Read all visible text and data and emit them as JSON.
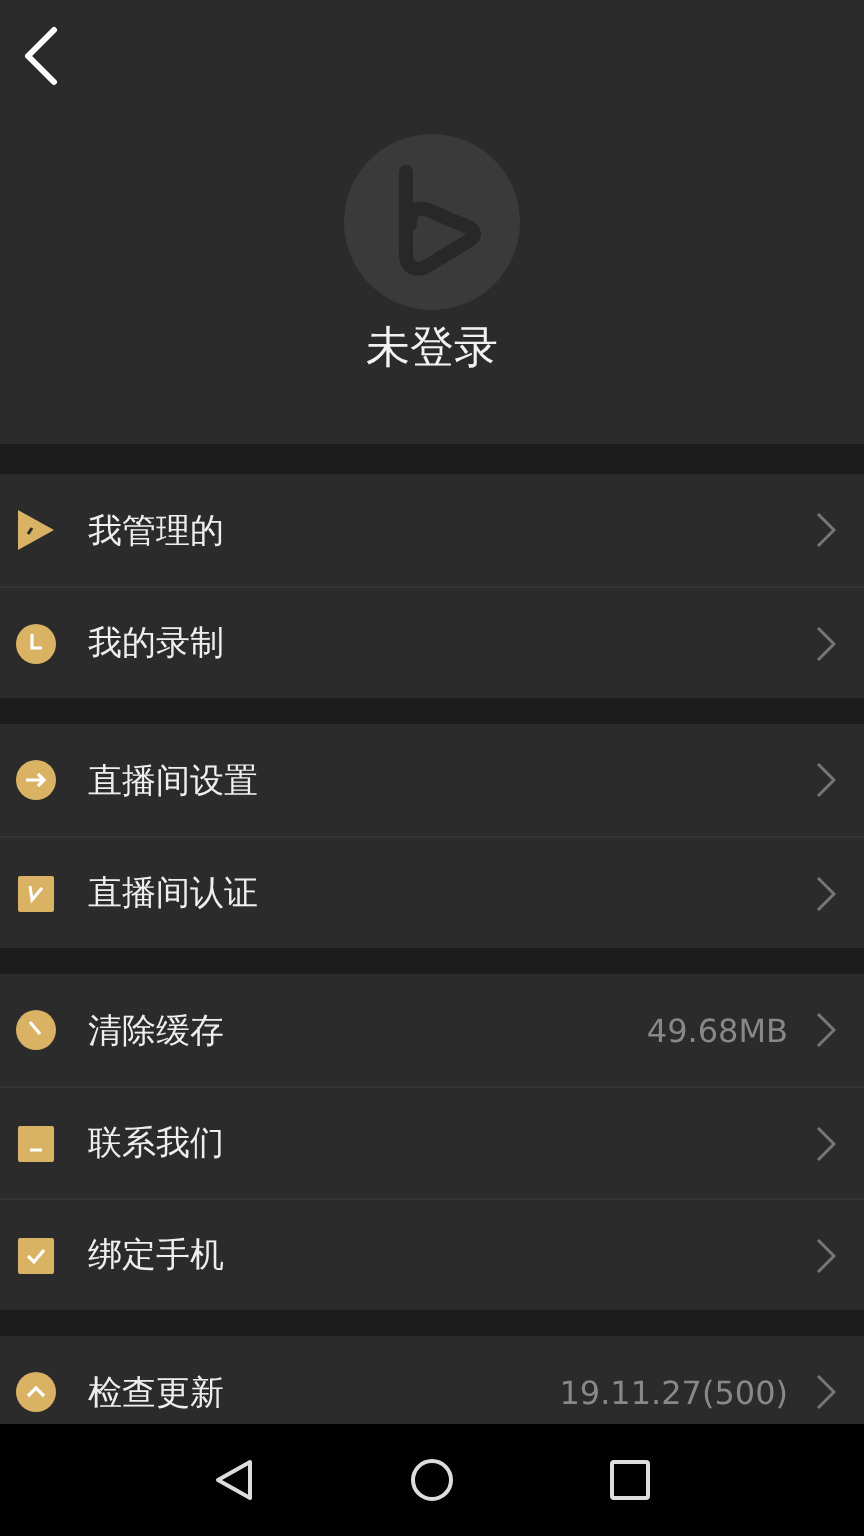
{
  "header": {
    "user_name": "未登录"
  },
  "groups": [
    {
      "items": [
        {
          "label": "我管理的"
        },
        {
          "label": "我的录制"
        }
      ]
    },
    {
      "items": [
        {
          "label": "直播间设置"
        },
        {
          "label": "直播间认证"
        }
      ]
    },
    {
      "items": [
        {
          "label": "清除缓存",
          "value": "49.68MB"
        },
        {
          "label": "联系我们"
        },
        {
          "label": "绑定手机"
        }
      ]
    },
    {
      "items": [
        {
          "label": "检查更新",
          "value": "19.11.27(500)"
        }
      ]
    }
  ]
}
